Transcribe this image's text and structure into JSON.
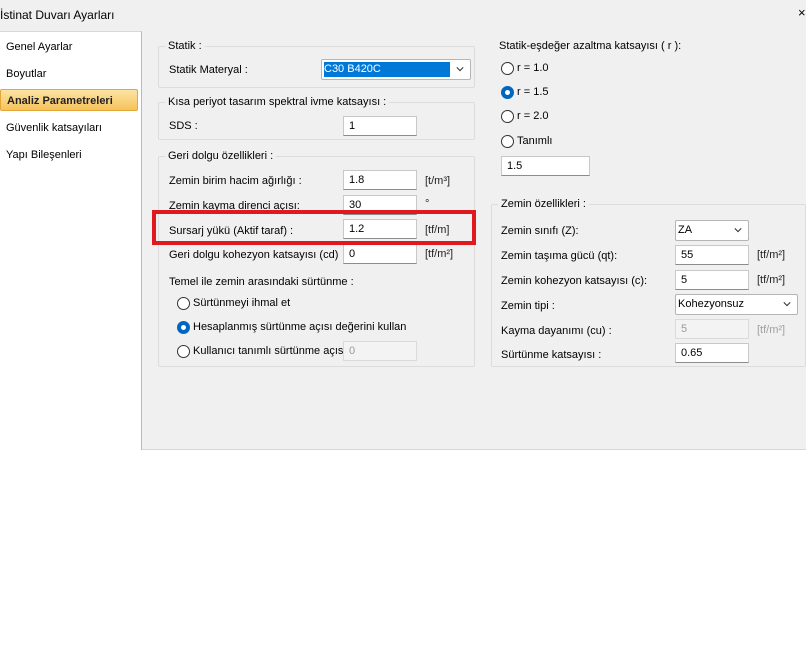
{
  "window": {
    "title": "İstinat Duvarı Ayarları",
    "close_glyph": "×"
  },
  "sidebar": {
    "items": [
      {
        "label": "Genel Ayarlar"
      },
      {
        "label": "Boyutlar"
      },
      {
        "label": "Analiz Parametreleri"
      },
      {
        "label": "Güvenlik katsayıları"
      },
      {
        "label": "Yapı Bileşenleri"
      }
    ],
    "active_index": 2
  },
  "statik": {
    "title": "Statik :",
    "material_label": "Statik Materyal :",
    "material_value": "C30 B420C"
  },
  "spektral": {
    "title": "Kısa periyot tasarım spektral ivme katsayısı :",
    "sds_label": "SDS :",
    "sds_value": "1"
  },
  "geri_dolgu": {
    "title": "Geri dolgu özellikleri :",
    "rows": [
      {
        "label": "Zemin birim hacim ağırlığı :",
        "value": "1.8",
        "unit": "[t/m³]"
      },
      {
        "label": "Zemin kayma direnci açısı:",
        "value": "30",
        "unit": "°"
      },
      {
        "label": "Sursarj yükü (Aktif taraf) :",
        "value": "1.2",
        "unit": "[tf/m]"
      },
      {
        "label": "Geri dolgu kohezyon katsayısı (cd)",
        "value": "0",
        "unit": "[tf/m²]"
      }
    ],
    "friction_title": "Temel ile zemin arasındaki sürtünme :",
    "friction_options": [
      {
        "label": "Sürtünmeyi ihmal et",
        "checked": false
      },
      {
        "label": "Hesaplanmış sürtünme açısı değerini kullan",
        "checked": true
      },
      {
        "label": "Kullanıcı tanımlı sürtünme açısı :",
        "checked": false
      }
    ],
    "user_friction_value": "0"
  },
  "azaltma": {
    "title": "Statik-eşdeğer azaltma katsayısı ( r ):",
    "options": [
      {
        "label": "r = 1.0",
        "checked": false
      },
      {
        "label": "r = 1.5",
        "checked": true
      },
      {
        "label": "r = 2.0",
        "checked": false
      },
      {
        "label": "Tanımlı",
        "checked": false
      }
    ],
    "custom_value": "1.5"
  },
  "zemin": {
    "title": "Zemin özellikleri :",
    "sinif_label": "Zemin sınıfı (Z):",
    "sinif_value": "ZA",
    "tasima_label": "Zemin taşıma gücü (qt):",
    "tasima_value": "55",
    "tasima_unit": "[tf/m²]",
    "kohezyon_label": "Zemin kohezyon katsayısı (c):",
    "kohezyon_value": "5",
    "kohezyon_unit": "[tf/m²]",
    "tip_label": "Zemin tipi :",
    "tip_value": "Kohezyonsuz",
    "kayma_label": "Kayma dayanımı (cu) :",
    "kayma_value": "5",
    "kayma_unit": "[tf/m²]",
    "surtunme_label": "Sürtünme katsayısı :",
    "surtunme_value": "0.65"
  },
  "colors": {
    "accent": "#0078d7",
    "highlight_border": "#e0191f",
    "active_nav": "#f6c35a"
  }
}
